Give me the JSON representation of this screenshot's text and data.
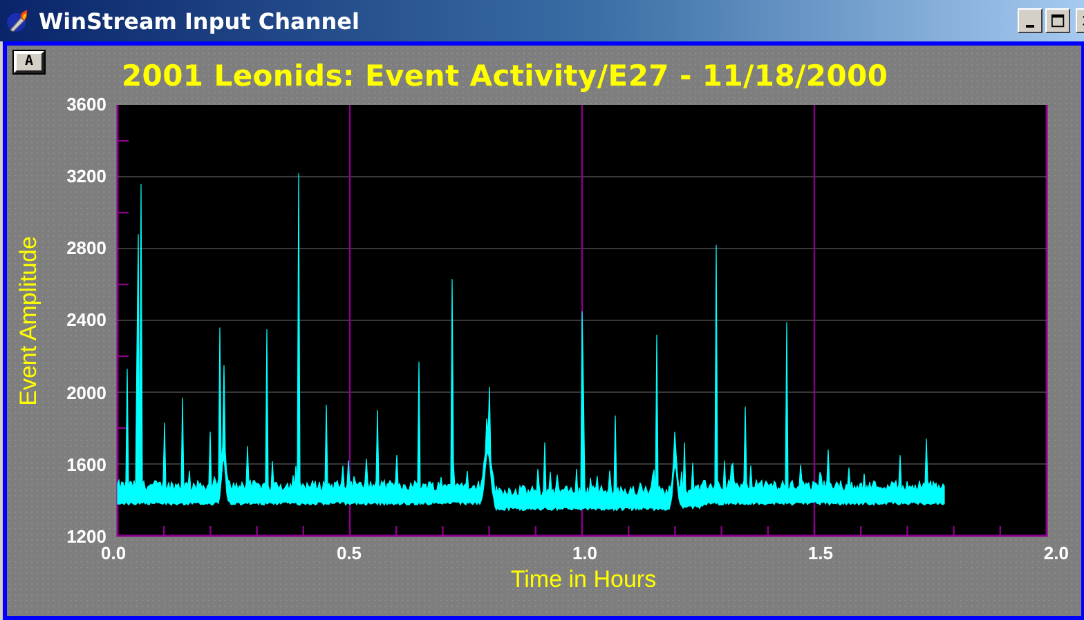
{
  "window": {
    "title": "WinStream Input Channel"
  },
  "corner_button": {
    "label": "A"
  },
  "chart": {
    "title": "2001 Leonids: Event Activity/E27 - 11/18/2000",
    "ylabel": "Event Amplitude",
    "xlabel": "Time in Hours",
    "y_ticks": [
      "3600",
      "3200",
      "2800",
      "2400",
      "2000",
      "1600",
      "1200"
    ],
    "x_ticks": [
      "0.0",
      "0.5",
      "1.0",
      "1.5",
      "2.0"
    ]
  }
}
